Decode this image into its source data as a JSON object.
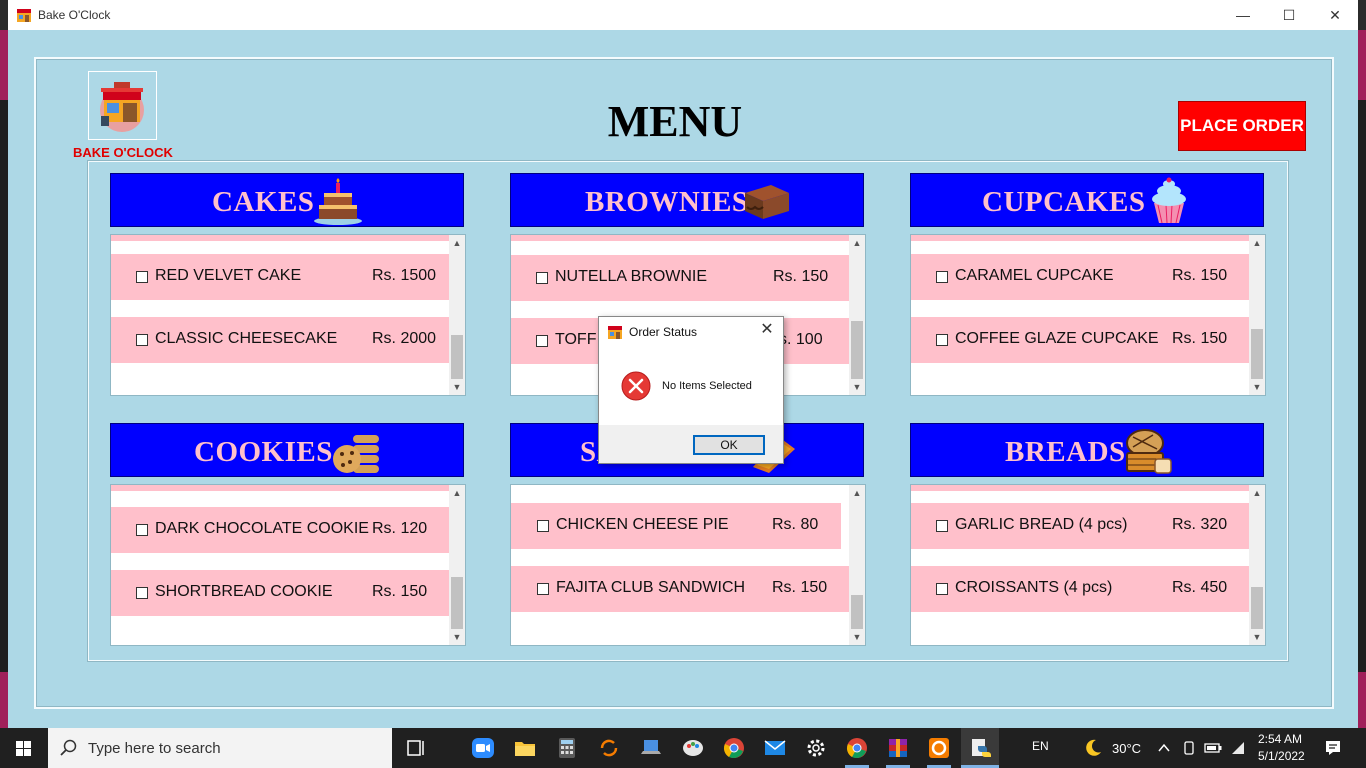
{
  "window": {
    "title": "Bake O'Clock",
    "minimize_icon": "minimize-icon",
    "maximize_icon": "maximize-icon",
    "close_icon": "close-icon"
  },
  "header": {
    "logo_label": "BAKE O'CLOCK",
    "menu_title": "MENU",
    "place_order_label": "PLACE ORDER"
  },
  "panels": [
    {
      "title": "CAKES",
      "icon": "cake-icon",
      "items": [
        {
          "name": "RED VELVET CAKE",
          "price": "Rs. 1500"
        },
        {
          "name": "CLASSIC CHEESECAKE",
          "price": "Rs. 2000"
        }
      ]
    },
    {
      "title": "BROWNIES",
      "icon": "brownie-icon",
      "items": [
        {
          "name": "NUTELLA BROWNIE",
          "price": "Rs. 150"
        },
        {
          "name": "TOFF",
          "price": "s. 100"
        }
      ]
    },
    {
      "title": "CUPCAKES",
      "icon": "cupcake-icon",
      "items": [
        {
          "name": "CARAMEL CUPCAKE",
          "price": "Rs. 150"
        },
        {
          "name": "COFFEE GLAZE CUPCAKE",
          "price": "Rs. 150"
        }
      ]
    },
    {
      "title": "COOKIES",
      "icon": "cookies-icon",
      "items": [
        {
          "name": "DARK CHOCOLATE COOKIE",
          "price": "Rs. 120"
        },
        {
          "name": "SHORTBREAD COOKIE",
          "price": "Rs. 150"
        }
      ]
    },
    {
      "title": "SA",
      "icon": "savory-icon",
      "items": [
        {
          "name": "CHICKEN CHEESE PIE",
          "price": "Rs. 80"
        },
        {
          "name": "FAJITA CLUB SANDWICH",
          "price": "Rs. 150"
        }
      ]
    },
    {
      "title": "BREADS",
      "icon": "bread-basket-icon",
      "items": [
        {
          "name": "GARLIC BREAD (4 pcs)",
          "price": "Rs. 320"
        },
        {
          "name": "CROISSANTS (4 pcs)",
          "price": "Rs. 450"
        }
      ]
    }
  ],
  "dialog": {
    "title": "Order Status",
    "message": "No Items Selected",
    "ok_label": "OK",
    "error_icon": "error-icon"
  },
  "taskbar": {
    "search_placeholder": "Type here to search",
    "language": "EN",
    "temperature": "30°C",
    "time": "2:54 AM",
    "date": "5/1/2022"
  },
  "colors": {
    "background": "#add8e6",
    "header_blue": "#0000ff",
    "header_text": "#ffc0cb",
    "item_pink": "#ffc0cb",
    "place_order_red": "#ff0000"
  }
}
